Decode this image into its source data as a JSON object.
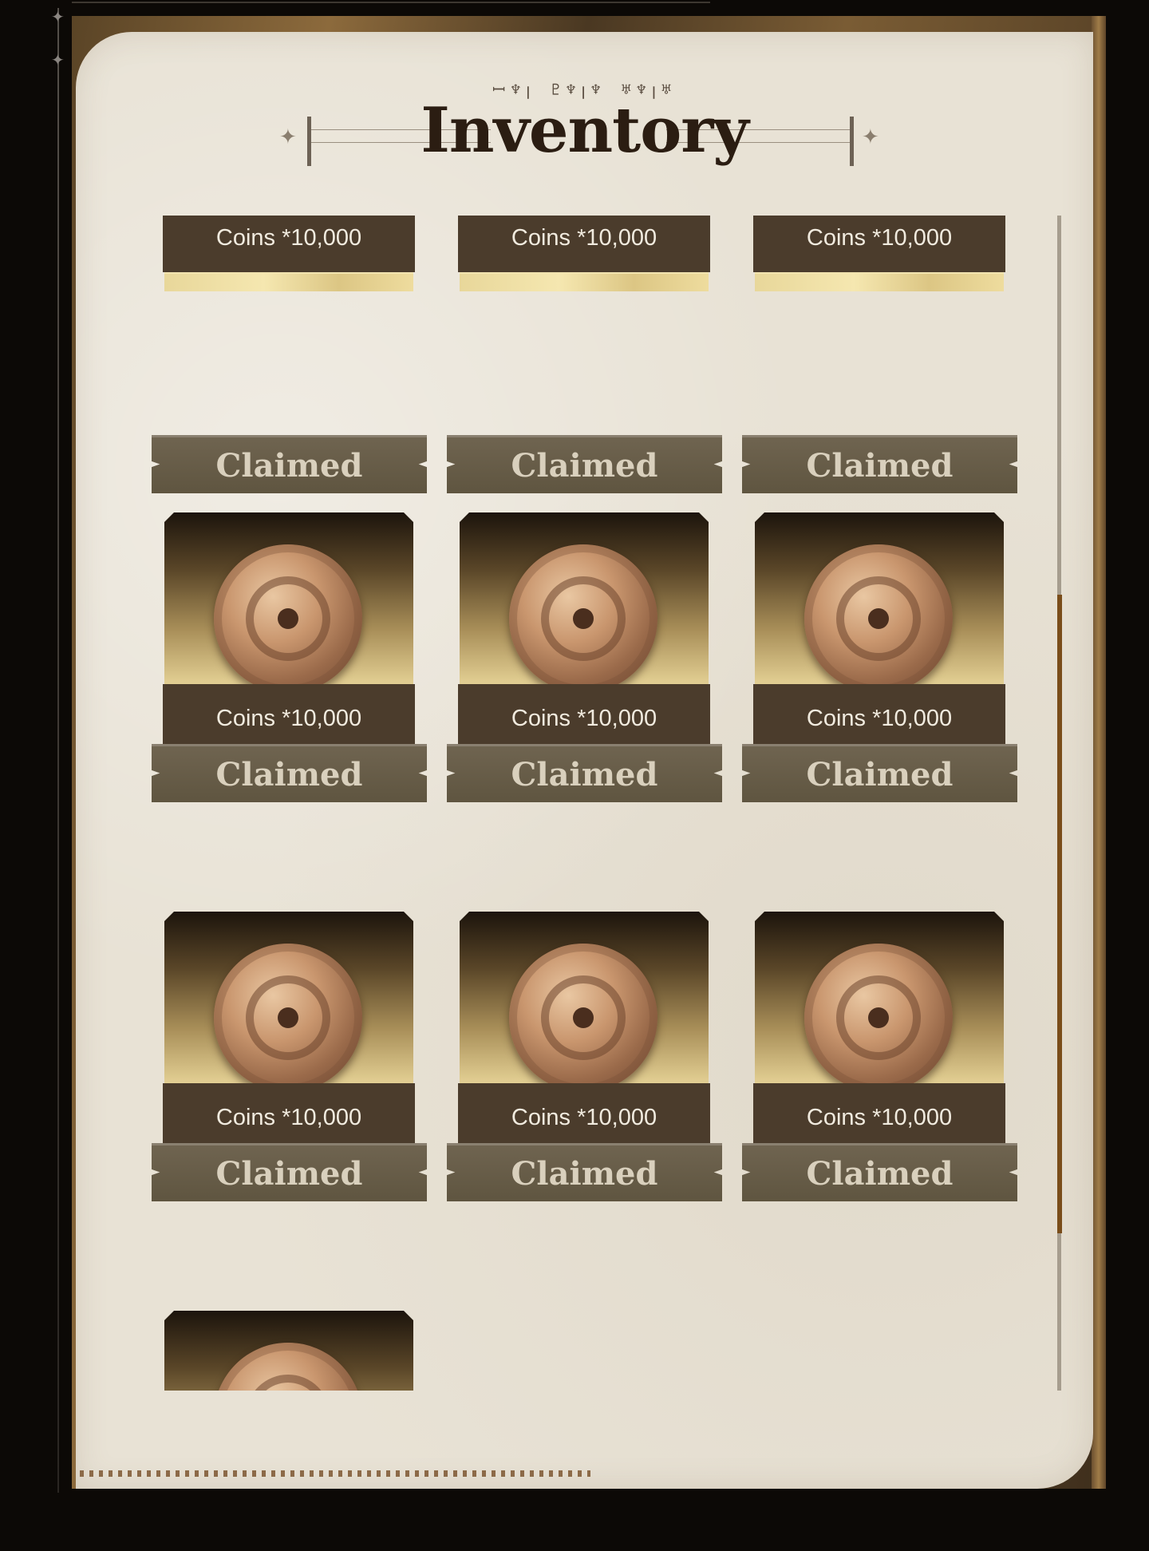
{
  "header": {
    "runes": "ꟷ♆ꞁ ♇♆ꞁ♆ ♅♆ꞁ♅",
    "title": "Inventory"
  },
  "items": [
    {
      "label": "Coins *10,000",
      "status": "Claimed"
    },
    {
      "label": "Coins *10,000",
      "status": "Claimed"
    },
    {
      "label": "Coins *10,000",
      "status": "Claimed"
    },
    {
      "label": "Coins *10,000",
      "status": "Claimed"
    },
    {
      "label": "Coins *10,000",
      "status": "Claimed"
    },
    {
      "label": "Coins *10,000",
      "status": "Claimed"
    },
    {
      "label": "Coins *10,000",
      "status": "Claimed"
    },
    {
      "label": "Coins *10,000",
      "status": "Claimed"
    },
    {
      "label": "Coins *10,000",
      "status": "Claimed"
    },
    {
      "label": "",
      "status": ""
    }
  ],
  "icons": {
    "reward": "coin-icon"
  },
  "colors": {
    "parchment": "#e8e2d5",
    "label_bg": "#4b3c2c",
    "claimed_bg": "#6f6450",
    "scroll_thumb": "#7a4d1a"
  },
  "scroll": {
    "position_fraction": 0.32,
    "visible_fraction": 0.54
  }
}
